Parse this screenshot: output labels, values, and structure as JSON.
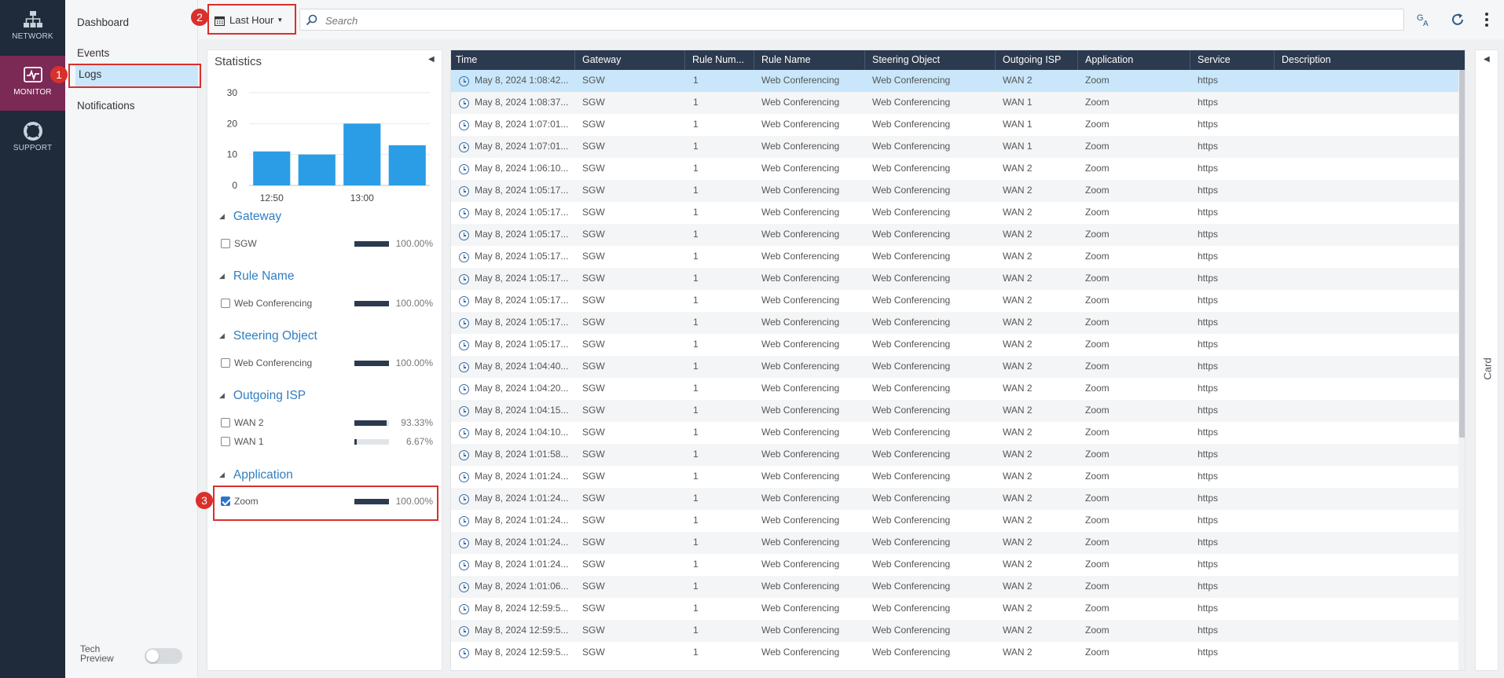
{
  "nav": {
    "items": [
      {
        "label": "NETWORK",
        "icon": "network-icon"
      },
      {
        "label": "MONITOR",
        "icon": "monitor-icon"
      },
      {
        "label": "SUPPORT",
        "icon": "support-icon"
      }
    ]
  },
  "subnav": {
    "items": [
      "Dashboard",
      "Events",
      "Logs",
      "Notifications"
    ],
    "tech_preview": "Tech\nPreview"
  },
  "toolbar": {
    "time_range": "Last Hour",
    "search_placeholder": "Search"
  },
  "stats": {
    "title": "Statistics",
    "sections": [
      {
        "title": "Gateway",
        "rows": [
          {
            "label": "SGW",
            "pct": "100.00%",
            "value": 100.0,
            "checked": false
          }
        ]
      },
      {
        "title": "Rule Name",
        "rows": [
          {
            "label": "Web Conferencing",
            "pct": "100.00%",
            "value": 100.0,
            "checked": false
          }
        ]
      },
      {
        "title": "Steering Object",
        "rows": [
          {
            "label": "Web Conferencing",
            "pct": "100.00%",
            "value": 100.0,
            "checked": false
          }
        ]
      },
      {
        "title": "Outgoing ISP",
        "rows": [
          {
            "label": "WAN 2",
            "pct": "93.33%",
            "value": 93.33,
            "checked": false
          },
          {
            "label": "WAN 1",
            "pct": "6.67%",
            "value": 6.67,
            "checked": false
          }
        ]
      },
      {
        "title": "Application",
        "rows": [
          {
            "label": "Zoom",
            "pct": "100.00%",
            "value": 100.0,
            "checked": true
          }
        ]
      }
    ]
  },
  "chart_data": {
    "type": "bar",
    "values": [
      11,
      10,
      20,
      13
    ],
    "x_tick_labels": [
      "12:50",
      "13:00"
    ],
    "y_ticks": [
      "0",
      "10",
      "20",
      "30"
    ],
    "ylim": [
      0,
      30
    ],
    "color": "#2a9de6"
  },
  "table": {
    "columns": [
      "Time",
      "Gateway",
      "Rule Num...",
      "Rule Name",
      "Steering Object",
      "Outgoing ISP",
      "Application",
      "Service",
      "Description"
    ],
    "rows": [
      [
        "May 8, 2024 1:08:42...",
        "SGW",
        "1",
        "Web Conferencing",
        "Web Conferencing",
        "WAN 2",
        "Zoom",
        "https",
        ""
      ],
      [
        "May 8, 2024 1:08:37...",
        "SGW",
        "1",
        "Web Conferencing",
        "Web Conferencing",
        "WAN 1",
        "Zoom",
        "https",
        ""
      ],
      [
        "May 8, 2024 1:07:01...",
        "SGW",
        "1",
        "Web Conferencing",
        "Web Conferencing",
        "WAN 1",
        "Zoom",
        "https",
        ""
      ],
      [
        "May 8, 2024 1:07:01...",
        "SGW",
        "1",
        "Web Conferencing",
        "Web Conferencing",
        "WAN 1",
        "Zoom",
        "https",
        ""
      ],
      [
        "May 8, 2024 1:06:10...",
        "SGW",
        "1",
        "Web Conferencing",
        "Web Conferencing",
        "WAN 2",
        "Zoom",
        "https",
        ""
      ],
      [
        "May 8, 2024 1:05:17...",
        "SGW",
        "1",
        "Web Conferencing",
        "Web Conferencing",
        "WAN 2",
        "Zoom",
        "https",
        ""
      ],
      [
        "May 8, 2024 1:05:17...",
        "SGW",
        "1",
        "Web Conferencing",
        "Web Conferencing",
        "WAN 2",
        "Zoom",
        "https",
        ""
      ],
      [
        "May 8, 2024 1:05:17...",
        "SGW",
        "1",
        "Web Conferencing",
        "Web Conferencing",
        "WAN 2",
        "Zoom",
        "https",
        ""
      ],
      [
        "May 8, 2024 1:05:17...",
        "SGW",
        "1",
        "Web Conferencing",
        "Web Conferencing",
        "WAN 2",
        "Zoom",
        "https",
        ""
      ],
      [
        "May 8, 2024 1:05:17...",
        "SGW",
        "1",
        "Web Conferencing",
        "Web Conferencing",
        "WAN 2",
        "Zoom",
        "https",
        ""
      ],
      [
        "May 8, 2024 1:05:17...",
        "SGW",
        "1",
        "Web Conferencing",
        "Web Conferencing",
        "WAN 2",
        "Zoom",
        "https",
        ""
      ],
      [
        "May 8, 2024 1:05:17...",
        "SGW",
        "1",
        "Web Conferencing",
        "Web Conferencing",
        "WAN 2",
        "Zoom",
        "https",
        ""
      ],
      [
        "May 8, 2024 1:05:17...",
        "SGW",
        "1",
        "Web Conferencing",
        "Web Conferencing",
        "WAN 2",
        "Zoom",
        "https",
        ""
      ],
      [
        "May 8, 2024 1:04:40...",
        "SGW",
        "1",
        "Web Conferencing",
        "Web Conferencing",
        "WAN 2",
        "Zoom",
        "https",
        ""
      ],
      [
        "May 8, 2024 1:04:20...",
        "SGW",
        "1",
        "Web Conferencing",
        "Web Conferencing",
        "WAN 2",
        "Zoom",
        "https",
        ""
      ],
      [
        "May 8, 2024 1:04:15...",
        "SGW",
        "1",
        "Web Conferencing",
        "Web Conferencing",
        "WAN 2",
        "Zoom",
        "https",
        ""
      ],
      [
        "May 8, 2024 1:04:10...",
        "SGW",
        "1",
        "Web Conferencing",
        "Web Conferencing",
        "WAN 2",
        "Zoom",
        "https",
        ""
      ],
      [
        "May 8, 2024 1:01:58...",
        "SGW",
        "1",
        "Web Conferencing",
        "Web Conferencing",
        "WAN 2",
        "Zoom",
        "https",
        ""
      ],
      [
        "May 8, 2024 1:01:24...",
        "SGW",
        "1",
        "Web Conferencing",
        "Web Conferencing",
        "WAN 2",
        "Zoom",
        "https",
        ""
      ],
      [
        "May 8, 2024 1:01:24...",
        "SGW",
        "1",
        "Web Conferencing",
        "Web Conferencing",
        "WAN 2",
        "Zoom",
        "https",
        ""
      ],
      [
        "May 8, 2024 1:01:24...",
        "SGW",
        "1",
        "Web Conferencing",
        "Web Conferencing",
        "WAN 2",
        "Zoom",
        "https",
        ""
      ],
      [
        "May 8, 2024 1:01:24...",
        "SGW",
        "1",
        "Web Conferencing",
        "Web Conferencing",
        "WAN 2",
        "Zoom",
        "https",
        ""
      ],
      [
        "May 8, 2024 1:01:24...",
        "SGW",
        "1",
        "Web Conferencing",
        "Web Conferencing",
        "WAN 2",
        "Zoom",
        "https",
        ""
      ],
      [
        "May 8, 2024 1:01:06...",
        "SGW",
        "1",
        "Web Conferencing",
        "Web Conferencing",
        "WAN 2",
        "Zoom",
        "https",
        ""
      ],
      [
        "May 8, 2024 12:59:5...",
        "SGW",
        "1",
        "Web Conferencing",
        "Web Conferencing",
        "WAN 2",
        "Zoom",
        "https",
        ""
      ],
      [
        "May 8, 2024 12:59:5...",
        "SGW",
        "1",
        "Web Conferencing",
        "Web Conferencing",
        "WAN 2",
        "Zoom",
        "https",
        ""
      ],
      [
        "May 8, 2024 12:59:5...",
        "SGW",
        "1",
        "Web Conferencing",
        "Web Conferencing",
        "WAN 2",
        "Zoom",
        "https",
        ""
      ]
    ],
    "selected_row": 0
  },
  "card_rail": {
    "label": "Card"
  },
  "callouts": [
    "1",
    "2",
    "3"
  ],
  "colors": {
    "nav_bg": "#1f2a3a",
    "nav_active": "#7a2a55",
    "header_bg": "#2c3a4f",
    "selection": "#c9e6fa",
    "accent_link": "#2f7ec3",
    "callout": "#d9302c"
  }
}
